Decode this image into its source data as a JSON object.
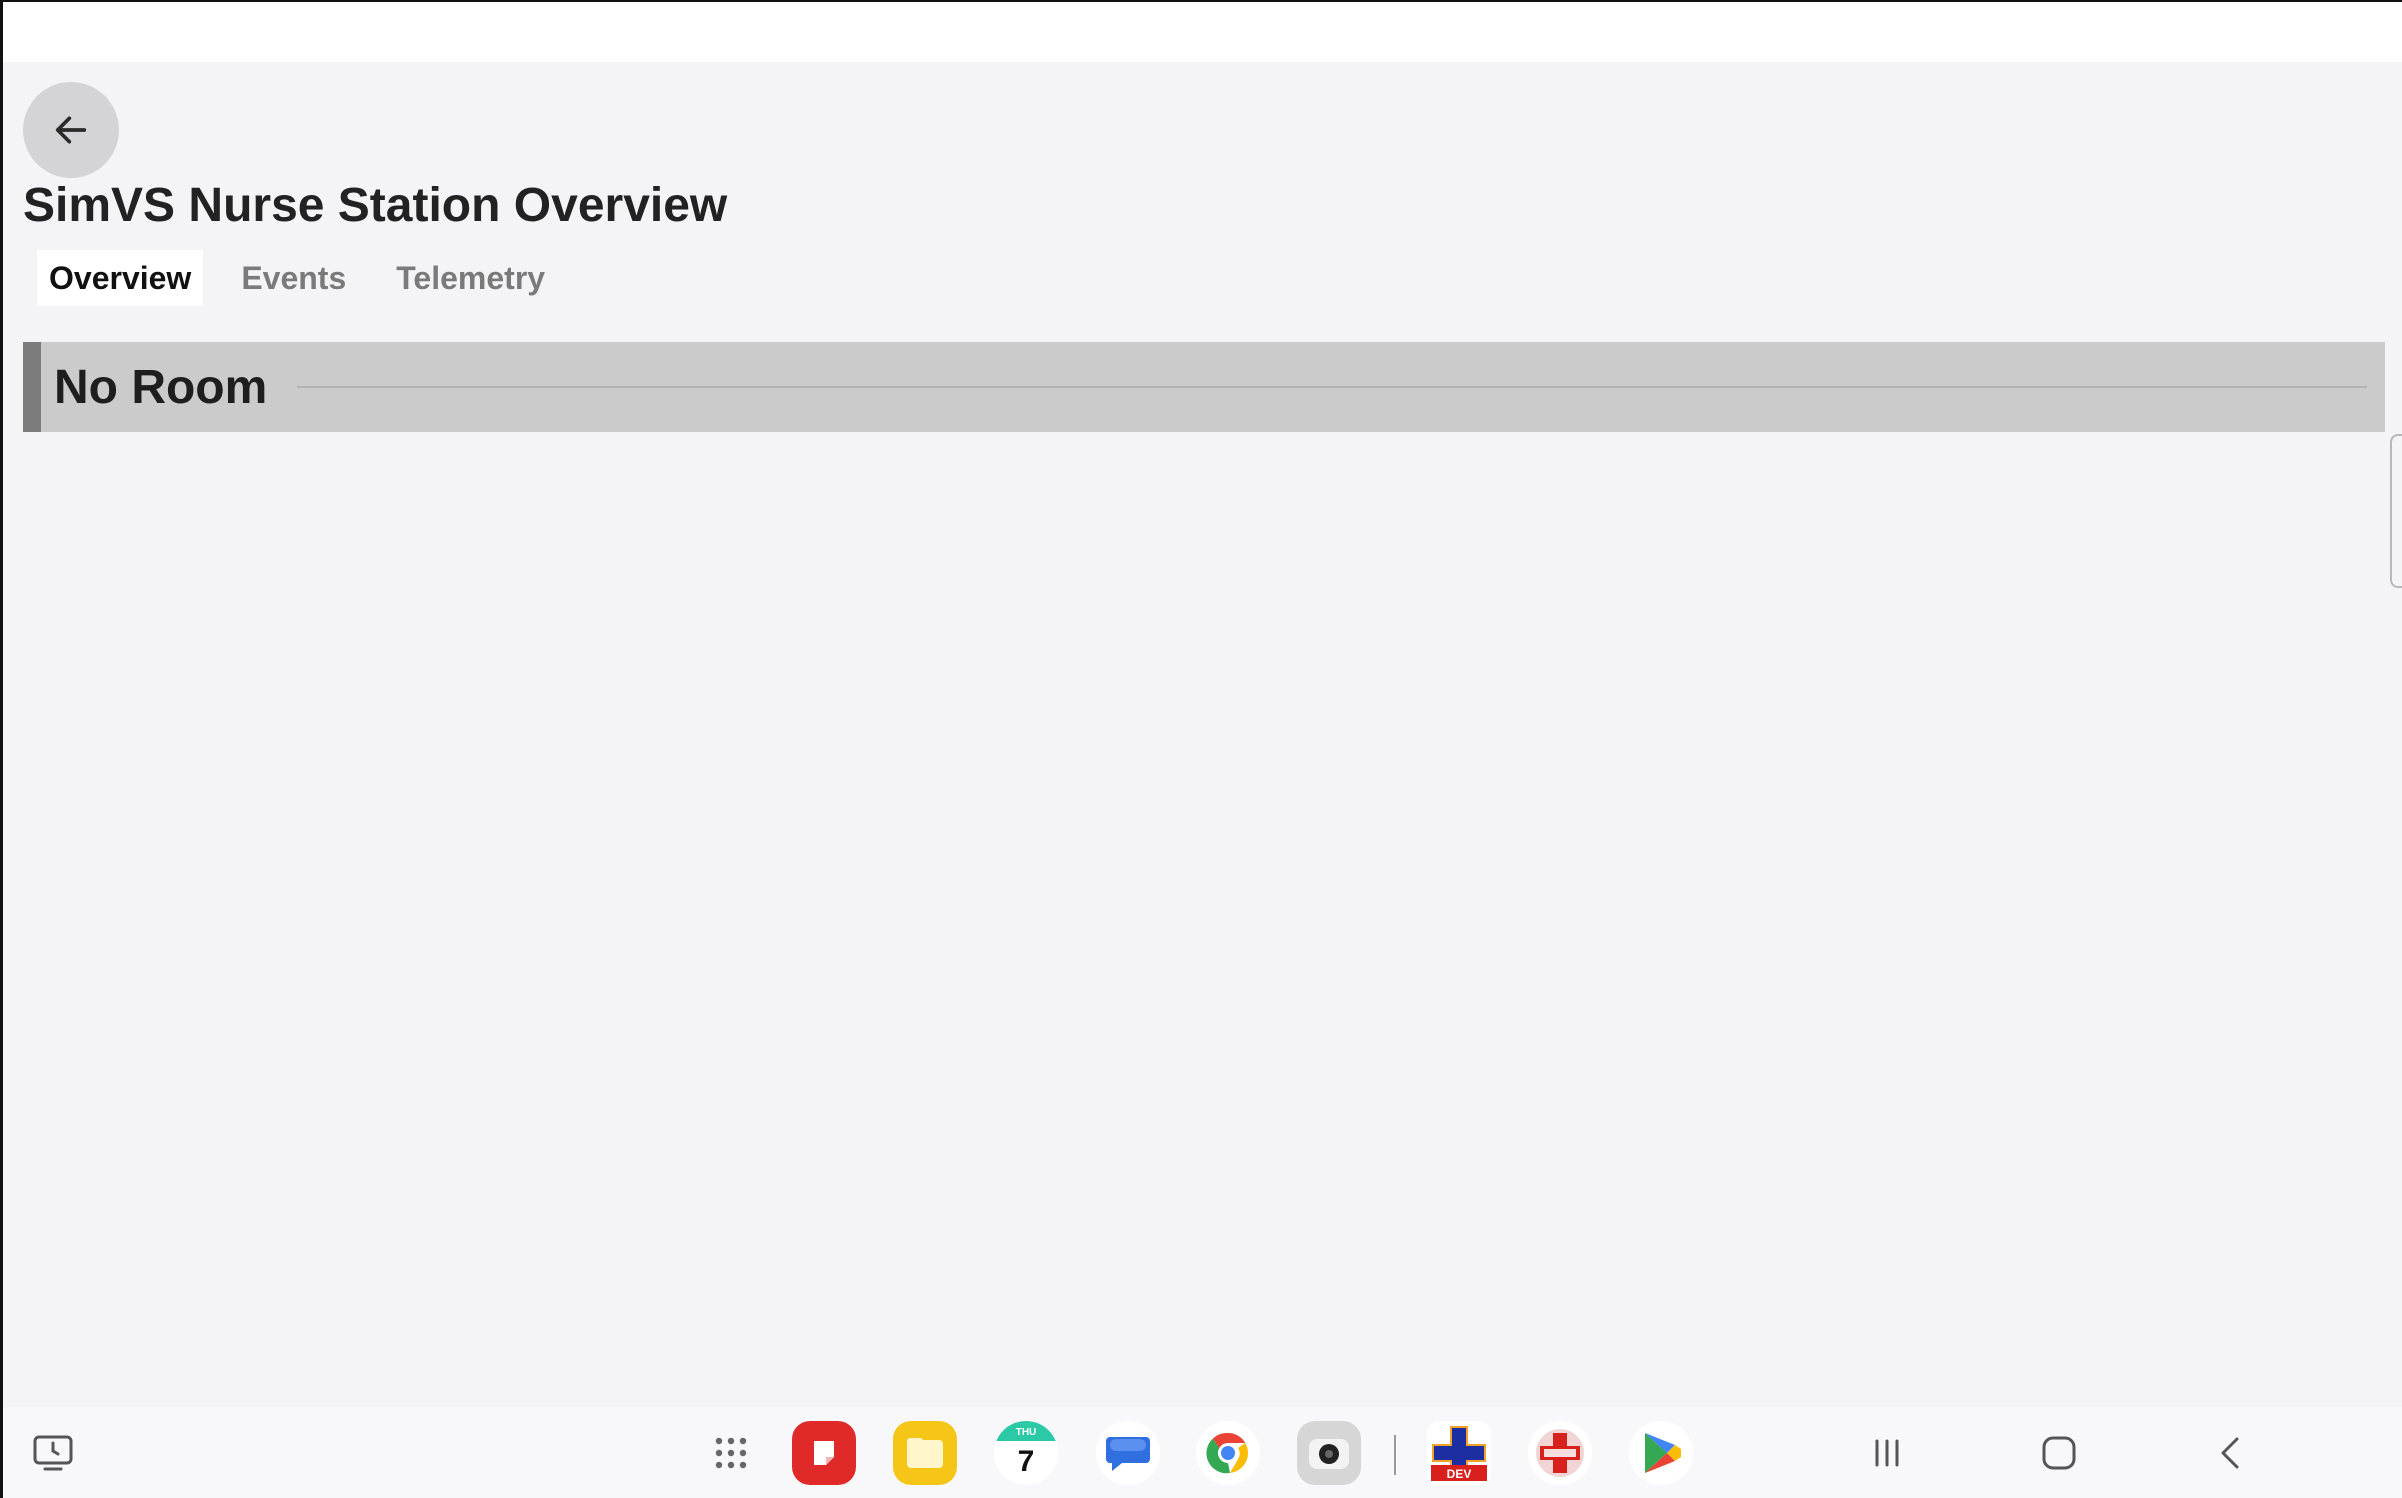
{
  "app": {
    "title": "SimVS Nurse Station Overview",
    "tabs": [
      {
        "label": "Overview",
        "active": true
      },
      {
        "label": "Events",
        "active": false
      },
      {
        "label": "Telemetry",
        "active": false
      }
    ],
    "room": {
      "title": "No Room"
    }
  },
  "taskbar": {
    "calendar": {
      "weekday": "THU",
      "day": "7"
    },
    "apps": [
      "all-apps-icon",
      "note-app-icon",
      "files-app-icon",
      "calendar-app-icon",
      "messages-app-icon",
      "chrome-icon",
      "camera-icon",
      "simvs-dev-app-icon",
      "simvs-app-icon",
      "play-store-icon"
    ],
    "nav": [
      "recents-icon",
      "home-icon",
      "back-nav-icon"
    ]
  },
  "colors": {
    "background": "#f4f4f6",
    "room_header": "#cbcbcb",
    "room_accent": "#7c7c7c",
    "tab_inactive": "#7a7a7a"
  }
}
